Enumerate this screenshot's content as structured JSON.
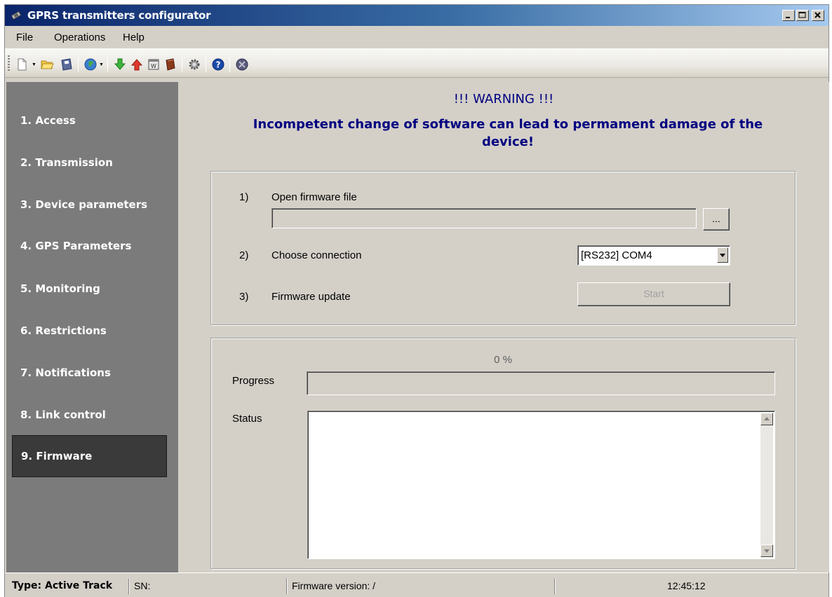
{
  "window": {
    "title": "GPRS transmitters configurator"
  },
  "menu": [
    "File",
    "Operations",
    "Help"
  ],
  "toolbar": {
    "icons": [
      "new-icon",
      "open-folder-icon",
      "save-icon",
      "globe-icon",
      "download-arrow-icon",
      "upload-arrow-icon",
      "calendar-icon",
      "book-icon",
      "settings-gear-icon",
      "help-icon",
      "exit-icon"
    ]
  },
  "sidebar": {
    "items": [
      {
        "label": "1. Access"
      },
      {
        "label": "2. Transmission"
      },
      {
        "label": "3. Device parameters"
      },
      {
        "label": "4. GPS Parameters"
      },
      {
        "label": "5. Monitoring"
      },
      {
        "label": "6. Restrictions"
      },
      {
        "label": "7. Notifications"
      },
      {
        "label": "8. Link control"
      },
      {
        "label": "9. Firmware"
      }
    ],
    "active_index": 8
  },
  "main": {
    "warning_title": "!!! WARNING !!!",
    "warning_text": "Incompetent change of software can lead to permament damage of the device!",
    "step1": {
      "number": "1)",
      "label": "Open firmware file",
      "file_value": "",
      "browse_label": "..."
    },
    "step2": {
      "number": "2)",
      "label": "Choose connection",
      "selected": "[RS232] COM4"
    },
    "step3": {
      "number": "3)",
      "label": "Firmware update",
      "button_label": "Start"
    },
    "progress": {
      "percent_text": "0 %",
      "label": "Progress",
      "value": 0
    },
    "status": {
      "label": "Status",
      "text": ""
    }
  },
  "statusbar": {
    "type": "Type: Active Track",
    "sn": "SN:",
    "firmware": "Firmware version: /",
    "time": "12:45:12"
  },
  "colors": {
    "title_start": "#0a246a",
    "title_end": "#a6caf0",
    "sidebar_bg": "#7b7b7b",
    "sidebar_active": "#3a3a3a",
    "warning_text": "#000080"
  }
}
